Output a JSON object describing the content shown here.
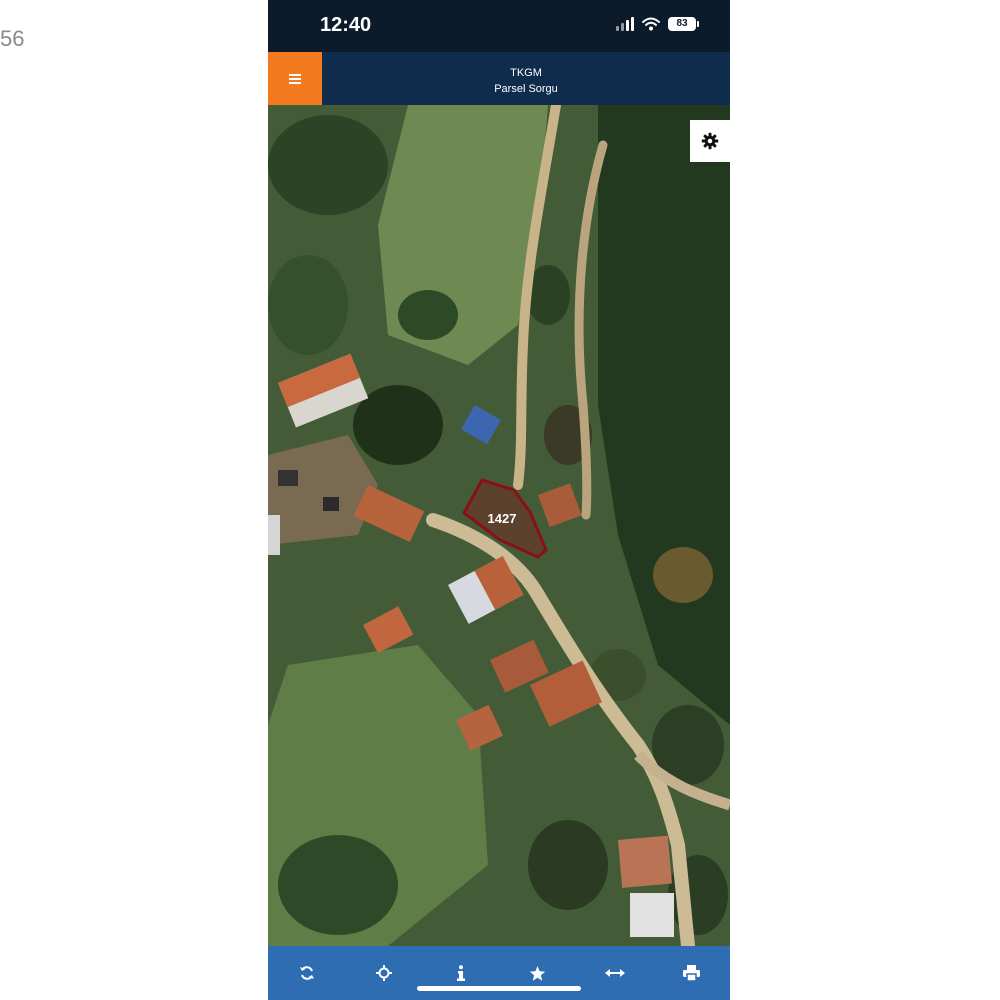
{
  "edge_text": "56",
  "status_bar": {
    "time": "12:40",
    "battery": "83",
    "icons": [
      "signal-icon",
      "wifi-icon",
      "battery-icon"
    ]
  },
  "header": {
    "title": "TKGM",
    "subtitle": "Parsel Sorgu",
    "menu_icon": "hamburger-menu-icon"
  },
  "map": {
    "parcel_label": "1427",
    "settings_icon": "gear-icon"
  },
  "toolbar": {
    "items": [
      {
        "icon": "refresh-icon"
      },
      {
        "icon": "location-target-icon"
      },
      {
        "icon": "info-icon"
      },
      {
        "icon": "star-icon"
      },
      {
        "icon": "measure-icon"
      },
      {
        "icon": "print-icon"
      }
    ]
  },
  "colors": {
    "menu_button": "#f47a20",
    "header": "#102c4c",
    "status_bar": "#0c1b2c",
    "toolbar": "#2f6db3",
    "parcel_outline": "#8b0f1a"
  }
}
